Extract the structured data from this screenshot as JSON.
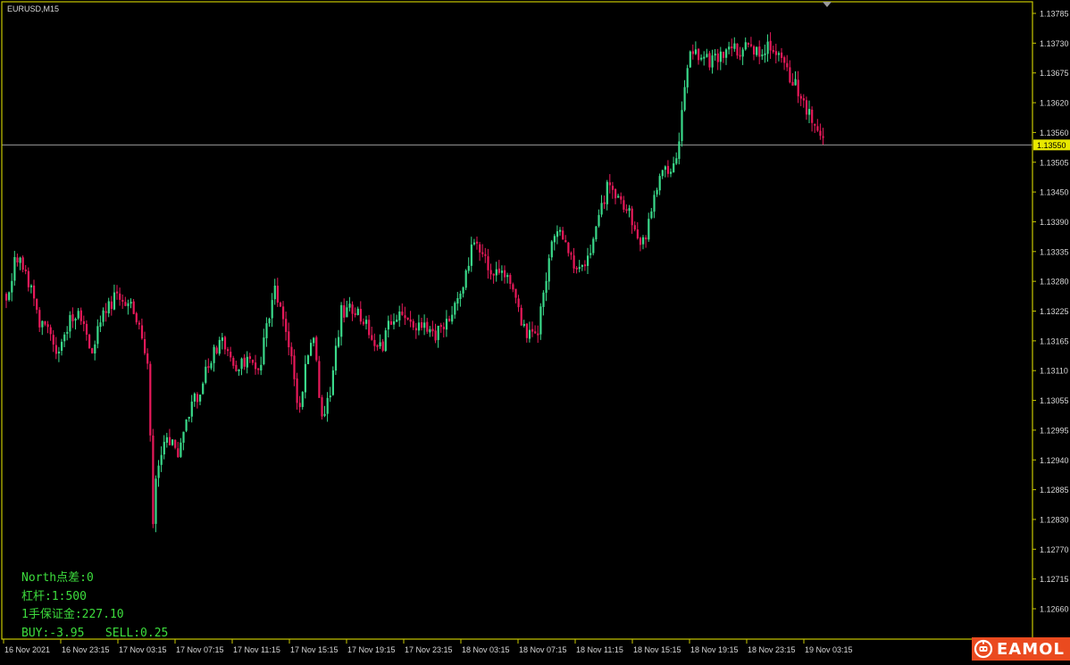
{
  "window": {
    "symbol_title": "EURUSD,M15"
  },
  "info_panel": {
    "spread_line": "North点差:0",
    "leverage_line": "杠杆:1:500",
    "margin_line": "1手保证金:227.10",
    "swap_line": "BUY:-3.95   SELL:0.25"
  },
  "price_axis": {
    "labels": [
      "1.13785",
      "1.13730",
      "1.13675",
      "1.13620",
      "1.13560",
      "1.13505",
      "1.13450",
      "1.13390",
      "1.13335",
      "1.13280",
      "1.13225",
      "1.13165",
      "1.13110",
      "1.13055",
      "1.12995",
      "1.12940",
      "1.12885",
      "1.12830",
      "1.12770",
      "1.12715",
      "1.12660"
    ],
    "current_price_label": "1.13550"
  },
  "time_axis": {
    "labels": [
      "16 Nov 2021",
      "16 Nov 23:15",
      "17 Nov 03:15",
      "17 Nov 07:15",
      "17 Nov 11:15",
      "17 Nov 15:15",
      "17 Nov 19:15",
      "17 Nov 23:15",
      "18 Nov 03:15",
      "18 Nov 07:15",
      "18 Nov 11:15",
      "18 Nov 15:15",
      "18 Nov 19:15",
      "18 Nov 23:15",
      "19 Nov 03:15"
    ]
  },
  "logo": {
    "text": "EAMOL"
  },
  "colors": {
    "background": "#000000",
    "frame": "#c8c800",
    "bull": "#3ad98a",
    "bear": "#e8195a",
    "axis_text": "#d8d8d8",
    "info_text": "#3ddc3d",
    "price_line": "#9a9a9a",
    "price_tag_bg": "#e8e800",
    "logo_bg": "#ea4a1f"
  },
  "chart_data": {
    "type": "candlestick",
    "symbol": "EURUSD",
    "timeframe": "M15",
    "ylim": [
      1.12635,
      1.13815
    ],
    "current_price": 1.1355,
    "anchors": [
      {
        "x": 8,
        "y": 330
      },
      {
        "x": 18,
        "y": 290
      },
      {
        "x": 28,
        "y": 300
      },
      {
        "x": 42,
        "y": 355
      },
      {
        "x": 55,
        "y": 375
      },
      {
        "x": 65,
        "y": 405
      },
      {
        "x": 78,
        "y": 360
      },
      {
        "x": 90,
        "y": 355
      },
      {
        "x": 103,
        "y": 395
      },
      {
        "x": 115,
        "y": 355
      },
      {
        "x": 133,
        "y": 330
      },
      {
        "x": 150,
        "y": 345
      },
      {
        "x": 160,
        "y": 385
      },
      {
        "x": 168,
        "y": 420
      },
      {
        "x": 170,
        "y": 610
      },
      {
        "x": 176,
        "y": 525
      },
      {
        "x": 185,
        "y": 490
      },
      {
        "x": 200,
        "y": 505
      },
      {
        "x": 218,
        "y": 450
      },
      {
        "x": 232,
        "y": 415
      },
      {
        "x": 240,
        "y": 390
      },
      {
        "x": 250,
        "y": 380
      },
      {
        "x": 262,
        "y": 410
      },
      {
        "x": 278,
        "y": 405
      },
      {
        "x": 290,
        "y": 420
      },
      {
        "x": 300,
        "y": 360
      },
      {
        "x": 308,
        "y": 320
      },
      {
        "x": 318,
        "y": 360
      },
      {
        "x": 328,
        "y": 405
      },
      {
        "x": 335,
        "y": 470
      },
      {
        "x": 345,
        "y": 395
      },
      {
        "x": 352,
        "y": 385
      },
      {
        "x": 362,
        "y": 480
      },
      {
        "x": 372,
        "y": 430
      },
      {
        "x": 382,
        "y": 350
      },
      {
        "x": 395,
        "y": 345
      },
      {
        "x": 410,
        "y": 365
      },
      {
        "x": 425,
        "y": 395
      },
      {
        "x": 440,
        "y": 355
      },
      {
        "x": 458,
        "y": 360
      },
      {
        "x": 475,
        "y": 370
      },
      {
        "x": 490,
        "y": 375
      },
      {
        "x": 505,
        "y": 350
      },
      {
        "x": 515,
        "y": 340
      },
      {
        "x": 522,
        "y": 305
      },
      {
        "x": 530,
        "y": 265
      },
      {
        "x": 540,
        "y": 285
      },
      {
        "x": 550,
        "y": 305
      },
      {
        "x": 565,
        "y": 310
      },
      {
        "x": 578,
        "y": 340
      },
      {
        "x": 590,
        "y": 375
      },
      {
        "x": 603,
        "y": 365
      },
      {
        "x": 612,
        "y": 315
      },
      {
        "x": 620,
        "y": 265
      },
      {
        "x": 632,
        "y": 270
      },
      {
        "x": 645,
        "y": 305
      },
      {
        "x": 660,
        "y": 290
      },
      {
        "x": 668,
        "y": 245
      },
      {
        "x": 680,
        "y": 210
      },
      {
        "x": 695,
        "y": 220
      },
      {
        "x": 705,
        "y": 240
      },
      {
        "x": 712,
        "y": 265
      },
      {
        "x": 720,
        "y": 275
      },
      {
        "x": 730,
        "y": 230
      },
      {
        "x": 738,
        "y": 205
      },
      {
        "x": 745,
        "y": 180
      },
      {
        "x": 752,
        "y": 195
      },
      {
        "x": 760,
        "y": 160
      },
      {
        "x": 767,
        "y": 95
      },
      {
        "x": 775,
        "y": 55
      },
      {
        "x": 790,
        "y": 65
      },
      {
        "x": 800,
        "y": 70
      },
      {
        "x": 815,
        "y": 60
      },
      {
        "x": 830,
        "y": 55
      },
      {
        "x": 845,
        "y": 55
      },
      {
        "x": 860,
        "y": 55
      },
      {
        "x": 872,
        "y": 60
      },
      {
        "x": 880,
        "y": 80
      },
      {
        "x": 890,
        "y": 95
      },
      {
        "x": 898,
        "y": 110
      },
      {
        "x": 905,
        "y": 125
      },
      {
        "x": 912,
        "y": 140
      },
      {
        "x": 918,
        "y": 150
      },
      {
        "x": 921,
        "y": 149
      }
    ]
  }
}
